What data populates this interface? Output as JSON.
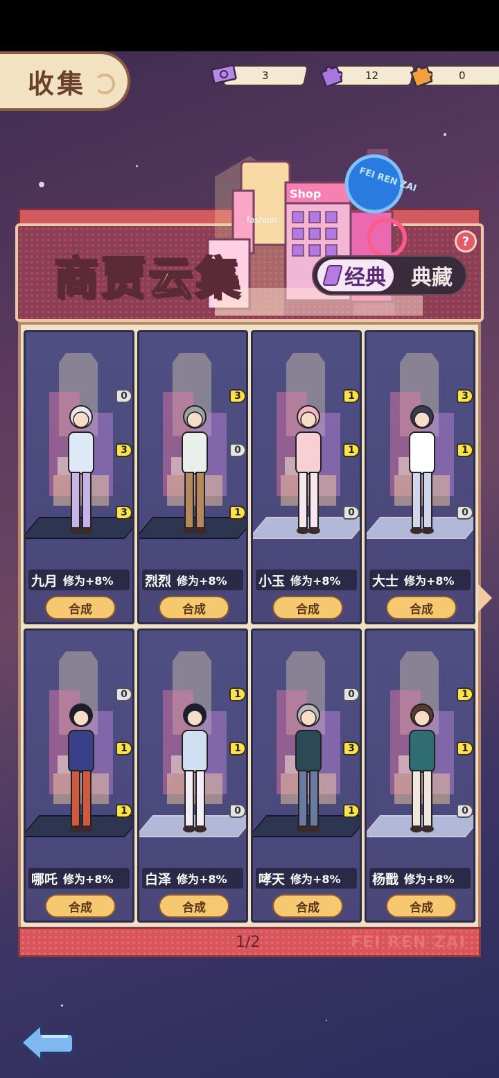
{
  "header": {
    "title": "收集"
  },
  "currencies": [
    {
      "icon": "ticket-icon",
      "value": "3"
    },
    {
      "icon": "purple-puzzle-icon",
      "value": "12"
    },
    {
      "icon": "orange-puzzle-icon",
      "value": "0"
    }
  ],
  "banner": {
    "title": "商贾云集",
    "tabs": {
      "classic": "经典",
      "collection": "典藏"
    },
    "help": "?"
  },
  "cards": [
    {
      "name": "九月",
      "bonus": "修为+8%",
      "button": "合成",
      "frags": [
        "0",
        "3",
        "3"
      ],
      "colors": [
        "#dfe8f7",
        "#c7b3e6"
      ],
      "hair": "#e8e6f0"
    },
    {
      "name": "烈烈",
      "bonus": "修为+8%",
      "button": "合成",
      "frags": [
        "3",
        "0",
        "1"
      ],
      "colors": [
        "#e9f0ec",
        "#b6885e"
      ],
      "hair": "#9aa6a2"
    },
    {
      "name": "小玉",
      "bonus": "修为+8%",
      "button": "合成",
      "frags": [
        "1",
        "1",
        "0"
      ],
      "colors": [
        "#f7cfd5",
        "#f7e7ef"
      ],
      "hair": "#f2b7c6"
    },
    {
      "name": "大士",
      "bonus": "修为+8%",
      "button": "合成",
      "frags": [
        "3",
        "1",
        "0"
      ],
      "colors": [
        "#ffffff",
        "#cfd6ee"
      ],
      "hair": "#3a3a50"
    },
    {
      "name": "哪吒",
      "bonus": "修为+8%",
      "button": "合成",
      "frags": [
        "0",
        "1",
        "1"
      ],
      "colors": [
        "#3a3f8a",
        "#d05a40"
      ],
      "hair": "#1c1c2a"
    },
    {
      "name": "白泽",
      "bonus": "修为+8%",
      "button": "合成",
      "frags": [
        "1",
        "1",
        "0"
      ],
      "colors": [
        "#cfdef1",
        "#f1eef5"
      ],
      "hair": "#1b1e30"
    },
    {
      "name": "哮天",
      "bonus": "修为+8%",
      "button": "合成",
      "frags": [
        "0",
        "3",
        "1"
      ],
      "colors": [
        "#2c4a55",
        "#6a7aa0"
      ],
      "hair": "#b8b8bf"
    },
    {
      "name": "杨戬",
      "bonus": "修为+8%",
      "button": "合成",
      "frags": [
        "1",
        "1",
        "0"
      ],
      "colors": [
        "#2e6d73",
        "#f0e8df"
      ],
      "hair": "#5a3a2a"
    }
  ],
  "pager": "1/2",
  "footer_brand": "FEI REN ZAI",
  "city_signs": {
    "neon": "FEI REN ZAI",
    "shop": "Shop",
    "fashion": "fashion"
  }
}
